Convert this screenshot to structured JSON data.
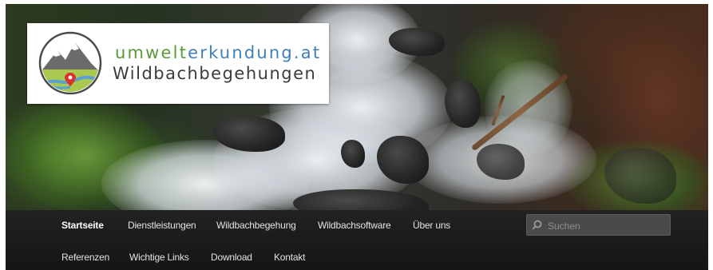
{
  "logo": {
    "domain_part1": "umwelt",
    "domain_part2": "erkundung.at",
    "subtitle": "Wildbachbegehungen",
    "colors": {
      "green": "#5a9a3a",
      "blue": "#3f7fb6",
      "dark": "#3c3c3c"
    }
  },
  "hero": {
    "icon": "mountain-stream-photo"
  },
  "nav": {
    "row1": [
      {
        "label": "Startseite",
        "active": true
      },
      {
        "label": "Dienstleistungen"
      },
      {
        "label": "Wildbachbegehung"
      },
      {
        "label": "Wildbachsoftware"
      },
      {
        "label": "Über uns"
      }
    ],
    "row2": [
      {
        "label": "Referenzen"
      },
      {
        "label": "Wichtige Links"
      },
      {
        "label": "Download"
      },
      {
        "label": "Kontakt"
      }
    ]
  },
  "search": {
    "placeholder": "Suchen",
    "value": ""
  }
}
